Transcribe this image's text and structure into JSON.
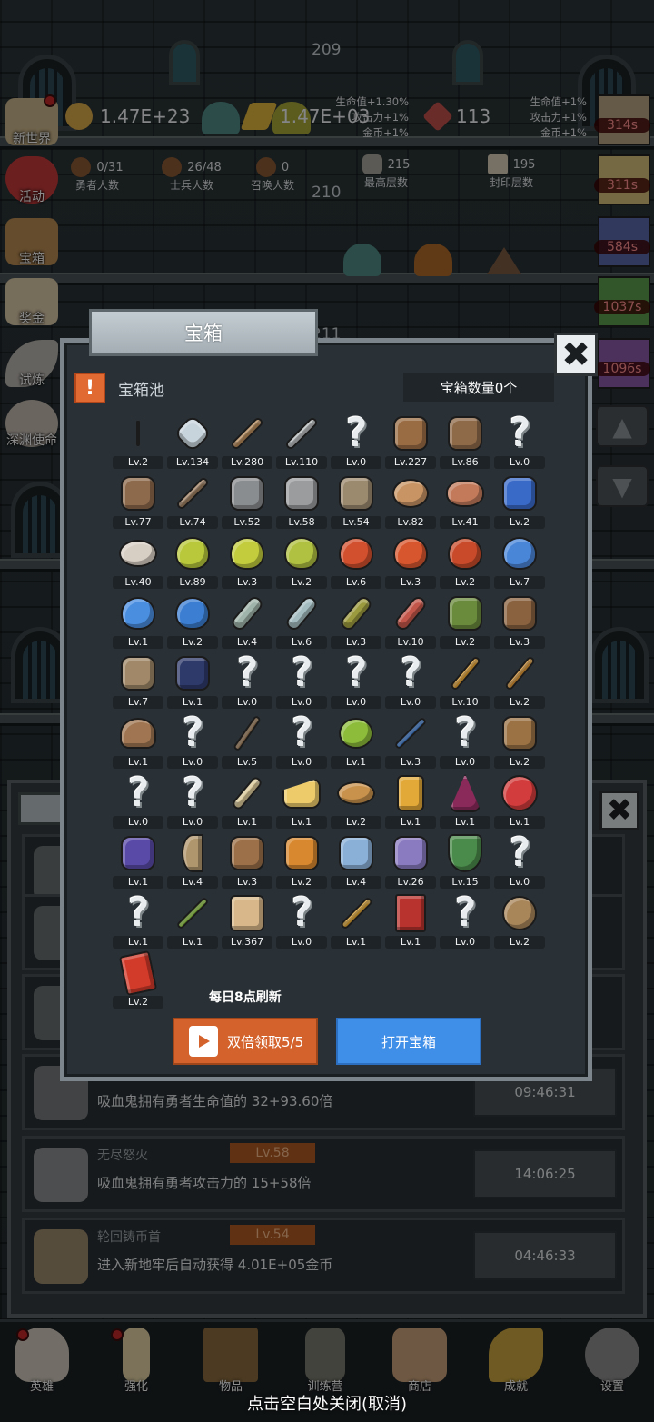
{
  "game": {
    "floors": [
      "209",
      "210",
      "211"
    ]
  },
  "resources": [
    {
      "name": "gold",
      "value": "1.47E+23",
      "color": "#d9a94a"
    },
    {
      "name": "gold-bar",
      "value": "1.47E+03",
      "color": "#e0b43c"
    },
    {
      "name": "ruby",
      "value": "113",
      "color": "#c0504a"
    }
  ],
  "bonus_left": [
    "生命值+1.30%",
    "攻击力+1%",
    "金币+1%"
  ],
  "bonus_right": [
    "生命值+1%",
    "攻击力+1%",
    "金币+1%"
  ],
  "stats": [
    {
      "value": "0/31",
      "label": "勇者人数"
    },
    {
      "value": "26/48",
      "label": "士兵人数"
    },
    {
      "value": "0",
      "label": "召唤人数"
    },
    {
      "value": "215",
      "label": "最高层数"
    },
    {
      "value": "195",
      "label": "封印层数"
    }
  ],
  "side_menu": [
    {
      "label": "新世界",
      "icon": "map-icon",
      "color": "#c9b48a"
    },
    {
      "label": "活动",
      "icon": "heart-icon",
      "color": "#c43a3a"
    },
    {
      "label": "宝箱",
      "icon": "chest-icon",
      "color": "#b88a52"
    },
    {
      "label": "奖金",
      "icon": "envelope-icon",
      "color": "#d8c6a6"
    },
    {
      "label": "试炼",
      "icon": "feather-icon",
      "color": "#b8b4ae"
    },
    {
      "label": "深渊使命",
      "icon": "orb-icon",
      "color": "#c2b8ae"
    }
  ],
  "timers": [
    {
      "value": "314s",
      "color": "#b8a284"
    },
    {
      "value": "311s",
      "color": "#d6c07a"
    },
    {
      "value": "584s",
      "color": "#5a6aa8"
    },
    {
      "value": "1037s",
      "color": "#5c9c4e"
    },
    {
      "value": "1096s",
      "color": "#8a5aa8"
    }
  ],
  "modal": {
    "title": "宝箱",
    "pool_title": "宝箱池",
    "count_label": "宝箱数量0个",
    "refresh_text": "每日8点刷新",
    "double_button": "双倍领取5/5",
    "open_button": "打开宝箱",
    "items": [
      {
        "lv": "Lv.2",
        "icon": "crown-icon",
        "color": "#e8b23a"
      },
      {
        "lv": "Lv.134",
        "icon": "diamond-icon",
        "color": "#c8d4dc"
      },
      {
        "lv": "Lv.280",
        "icon": "sword-icon",
        "color": "#b78a5a"
      },
      {
        "lv": "Lv.110",
        "icon": "sword-icon",
        "color": "#b9bcbe"
      },
      {
        "lv": "Lv.0",
        "icon": "unknown-icon"
      },
      {
        "lv": "Lv.227",
        "icon": "armor-icon",
        "color": "#9a6c44"
      },
      {
        "lv": "Lv.86",
        "icon": "backpack-icon",
        "color": "#8e6a48"
      },
      {
        "lv": "Lv.0",
        "icon": "unknown-icon"
      },
      {
        "lv": "Lv.77",
        "icon": "helmet-icon",
        "color": "#8e6a4c"
      },
      {
        "lv": "Lv.74",
        "icon": "sword-icon",
        "color": "#a08062"
      },
      {
        "lv": "Lv.52",
        "icon": "knight-helmet-icon",
        "color": "#8a8d8f"
      },
      {
        "lv": "Lv.58",
        "icon": "hammer-icon",
        "color": "#9a9c9e"
      },
      {
        "lv": "Lv.54",
        "icon": "great-helm-icon",
        "color": "#9c8a6e"
      },
      {
        "lv": "Lv.82",
        "icon": "meat-icon",
        "color": "#c89464"
      },
      {
        "lv": "Lv.41",
        "icon": "steak-icon",
        "color": "#c27a5a"
      },
      {
        "lv": "Lv.2",
        "icon": "blue-bag-icon",
        "color": "#3a6ac8"
      },
      {
        "lv": "Lv.40",
        "icon": "bread-icon",
        "color": "#d8cfc4"
      },
      {
        "lv": "Lv.89",
        "icon": "potion-yellow-icon",
        "color": "#b8c83a"
      },
      {
        "lv": "Lv.3",
        "icon": "potion-yellow-icon",
        "color": "#c2cc3c"
      },
      {
        "lv": "Lv.2",
        "icon": "potion-yellow-icon",
        "color": "#b0c040"
      },
      {
        "lv": "Lv.6",
        "icon": "potion-red-icon",
        "color": "#d2502e"
      },
      {
        "lv": "Lv.3",
        "icon": "potion-red-icon",
        "color": "#d8562e"
      },
      {
        "lv": "Lv.2",
        "icon": "potion-red-icon",
        "color": "#c84a2a"
      },
      {
        "lv": "Lv.7",
        "icon": "potion-blue-icon",
        "color": "#4a86d8"
      },
      {
        "lv": "Lv.1",
        "icon": "potion-blue-icon",
        "color": "#4a8ee0"
      },
      {
        "lv": "Lv.2",
        "icon": "potion-blue-icon",
        "color": "#3c7ed2"
      },
      {
        "lv": "Lv.4",
        "icon": "bottle-icon",
        "color": "#9fb4aa"
      },
      {
        "lv": "Lv.6",
        "icon": "bottle-icon",
        "color": "#a4bcc0"
      },
      {
        "lv": "Lv.3",
        "icon": "bottle-olive-icon",
        "color": "#9c9a3e"
      },
      {
        "lv": "Lv.10",
        "icon": "bottle-red-icon",
        "color": "#c2564a"
      },
      {
        "lv": "Lv.2",
        "icon": "winged-boot-icon",
        "color": "#6a8a3c"
      },
      {
        "lv": "Lv.3",
        "icon": "boot-icon",
        "color": "#8a6240"
      },
      {
        "lv": "Lv.7",
        "icon": "boot-icon",
        "color": "#a08868"
      },
      {
        "lv": "Lv.1",
        "icon": "boot-dark-icon",
        "color": "#2e3a6a"
      },
      {
        "lv": "Lv.0",
        "icon": "unknown-icon"
      },
      {
        "lv": "Lv.0",
        "icon": "unknown-icon"
      },
      {
        "lv": "Lv.0",
        "icon": "unknown-icon"
      },
      {
        "lv": "Lv.0",
        "icon": "unknown-icon"
      },
      {
        "lv": "Lv.10",
        "icon": "torch-icon",
        "color": "#e2a032"
      },
      {
        "lv": "Lv.2",
        "icon": "torch-icon",
        "color": "#d49234"
      },
      {
        "lv": "Lv.1",
        "icon": "mushroom-icon",
        "color": "#a07652"
      },
      {
        "lv": "Lv.0",
        "icon": "unknown-icon"
      },
      {
        "lv": "Lv.5",
        "icon": "staff-icon",
        "color": "#9c7a56"
      },
      {
        "lv": "Lv.0",
        "icon": "unknown-icon"
      },
      {
        "lv": "Lv.1",
        "icon": "lime-icon",
        "color": "#8cbc3a"
      },
      {
        "lv": "Lv.3",
        "icon": "wand-icon",
        "color": "#3a7ad0"
      },
      {
        "lv": "Lv.0",
        "icon": "unknown-icon"
      },
      {
        "lv": "Lv.2",
        "icon": "backpack-icon",
        "color": "#9a7244"
      },
      {
        "lv": "Lv.0",
        "icon": "unknown-icon"
      },
      {
        "lv": "Lv.0",
        "icon": "unknown-icon"
      },
      {
        "lv": "Lv.1",
        "icon": "bone-club-icon",
        "color": "#d8c89a"
      },
      {
        "lv": "Lv.1",
        "icon": "cheese-icon",
        "color": "#eecb6a"
      },
      {
        "lv": "Lv.2",
        "icon": "pie-icon",
        "color": "#c8924c"
      },
      {
        "lv": "Lv.1",
        "icon": "honey-jar-icon",
        "color": "#e2a838"
      },
      {
        "lv": "Lv.1",
        "icon": "crystal-icon",
        "color": "#8a2a5a"
      },
      {
        "lv": "Lv.1",
        "icon": "gem-orb-icon",
        "color": "#d23c3c"
      },
      {
        "lv": "Lv.1",
        "icon": "orb-box-icon",
        "color": "#5a4aa8"
      },
      {
        "lv": "Lv.4",
        "icon": "bow-icon",
        "color": "#b0966c"
      },
      {
        "lv": "Lv.3",
        "icon": "quiver-icon",
        "color": "#9c7048"
      },
      {
        "lv": "Lv.2",
        "icon": "gold-armor-icon",
        "color": "#d8882e"
      },
      {
        "lv": "Lv.4",
        "icon": "ice-armor-icon",
        "color": "#8ab0d8"
      },
      {
        "lv": "Lv.26",
        "icon": "cloud-armor-icon",
        "color": "#8a7ac0"
      },
      {
        "lv": "Lv.15",
        "icon": "shield-icon",
        "color": "#4a8a4a"
      },
      {
        "lv": "Lv.0",
        "icon": "unknown-icon"
      },
      {
        "lv": "Lv.1",
        "icon": "unknown-icon"
      },
      {
        "lv": "Lv.1",
        "icon": "green-wand-icon",
        "color": "#8cc83a"
      },
      {
        "lv": "Lv.367",
        "icon": "beer-mug-icon",
        "color": "#d8b88a"
      },
      {
        "lv": "Lv.0",
        "icon": "unknown-icon"
      },
      {
        "lv": "Lv.1",
        "icon": "pickaxe-icon",
        "color": "#e0a632"
      },
      {
        "lv": "Lv.1",
        "icon": "red-book-icon",
        "color": "#b8322e"
      },
      {
        "lv": "Lv.0",
        "icon": "unknown-icon"
      },
      {
        "lv": "Lv.2",
        "icon": "whip-icon",
        "color": "#a8865a"
      },
      {
        "lv": "Lv.2",
        "icon": "red-card-icon",
        "color": "#d23a2a"
      }
    ]
  },
  "list_rows": [
    {
      "name": "",
      "lvl": "",
      "desc": "吸血鬼拥有勇者生命值的 32+93.60倍",
      "time": "09:46:31",
      "icon": "knight-helmet-icon"
    },
    {
      "name": "无尽怒火",
      "lvl": "Lv.58",
      "desc": "吸血鬼拥有勇者攻击力的 15+58倍",
      "time": "14:06:25",
      "icon": "hammer-icon"
    },
    {
      "name": "轮回铸币首",
      "lvl": "Lv.54",
      "desc": "进入新地牢后自动获得 4.01E+05金币",
      "time": "04:46:33",
      "icon": "great-helm-icon"
    }
  ],
  "nav": [
    {
      "label": "英雄",
      "icon": "skull-icon",
      "color": "#cfc7bb"
    },
    {
      "label": "强化",
      "icon": "candle-icon",
      "color": "#e0cfa2"
    },
    {
      "label": "物品",
      "icon": "book-icon",
      "color": "#8a6a3e"
    },
    {
      "label": "训练营",
      "icon": "lantern-icon",
      "color": "#7a7a70"
    },
    {
      "label": "商店",
      "icon": "beer-mug-icon",
      "color": "#c9a17a"
    },
    {
      "label": "成就",
      "icon": "key-icon",
      "color": "#c9a53e"
    },
    {
      "label": "设置",
      "icon": "gear-icon",
      "color": "#8c8c8c"
    }
  ],
  "close_hint": "点击空白处关闭(取消)"
}
